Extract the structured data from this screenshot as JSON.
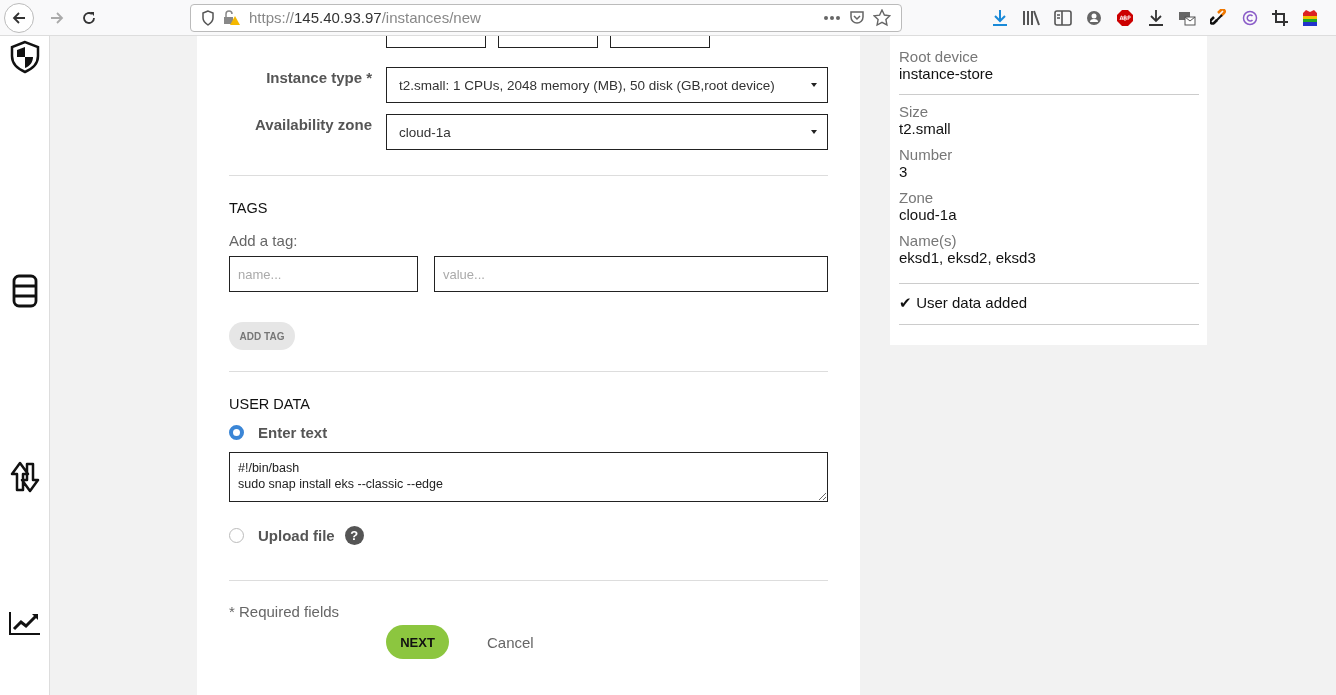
{
  "browser": {
    "url_scheme": "https://",
    "url_host": "145.40.93.97",
    "url_path": "/instances/new"
  },
  "form": {
    "fields": [
      {
        "label": "Instance type *",
        "value": "t2.small: 1 CPUs, 2048 memory (MB), 50 disk (GB,root device)"
      },
      {
        "label": "Availability zone",
        "value": "cloud-1a"
      }
    ],
    "tags": {
      "heading": "TAGS",
      "label": "Add a tag:",
      "name_placeholder": "name...",
      "value_placeholder": "value...",
      "button": "ADD TAG"
    },
    "user_data": {
      "heading": "USER DATA",
      "options": [
        {
          "label": "Enter text",
          "selected": true,
          "kind": "text"
        },
        {
          "label": "Upload file",
          "selected": false,
          "kind": "file"
        }
      ],
      "text": "#!/bin/bash\nsudo snap install eks --classic --edge",
      "help": "?"
    },
    "required_note": "* Required fields",
    "next": "NEXT",
    "cancel": "Cancel"
  },
  "summary": {
    "groups": [
      [
        {
          "label": "Root device",
          "value": "instance-store"
        }
      ],
      [
        {
          "label": "Size",
          "value": "t2.small"
        },
        {
          "label": "Number",
          "value": "3"
        },
        {
          "label": "Zone",
          "value": "cloud-1a"
        },
        {
          "label": "Name(s)",
          "value": "eksd1, eksd2, eksd3"
        }
      ]
    ],
    "check": "✔",
    "note": "User data added"
  }
}
